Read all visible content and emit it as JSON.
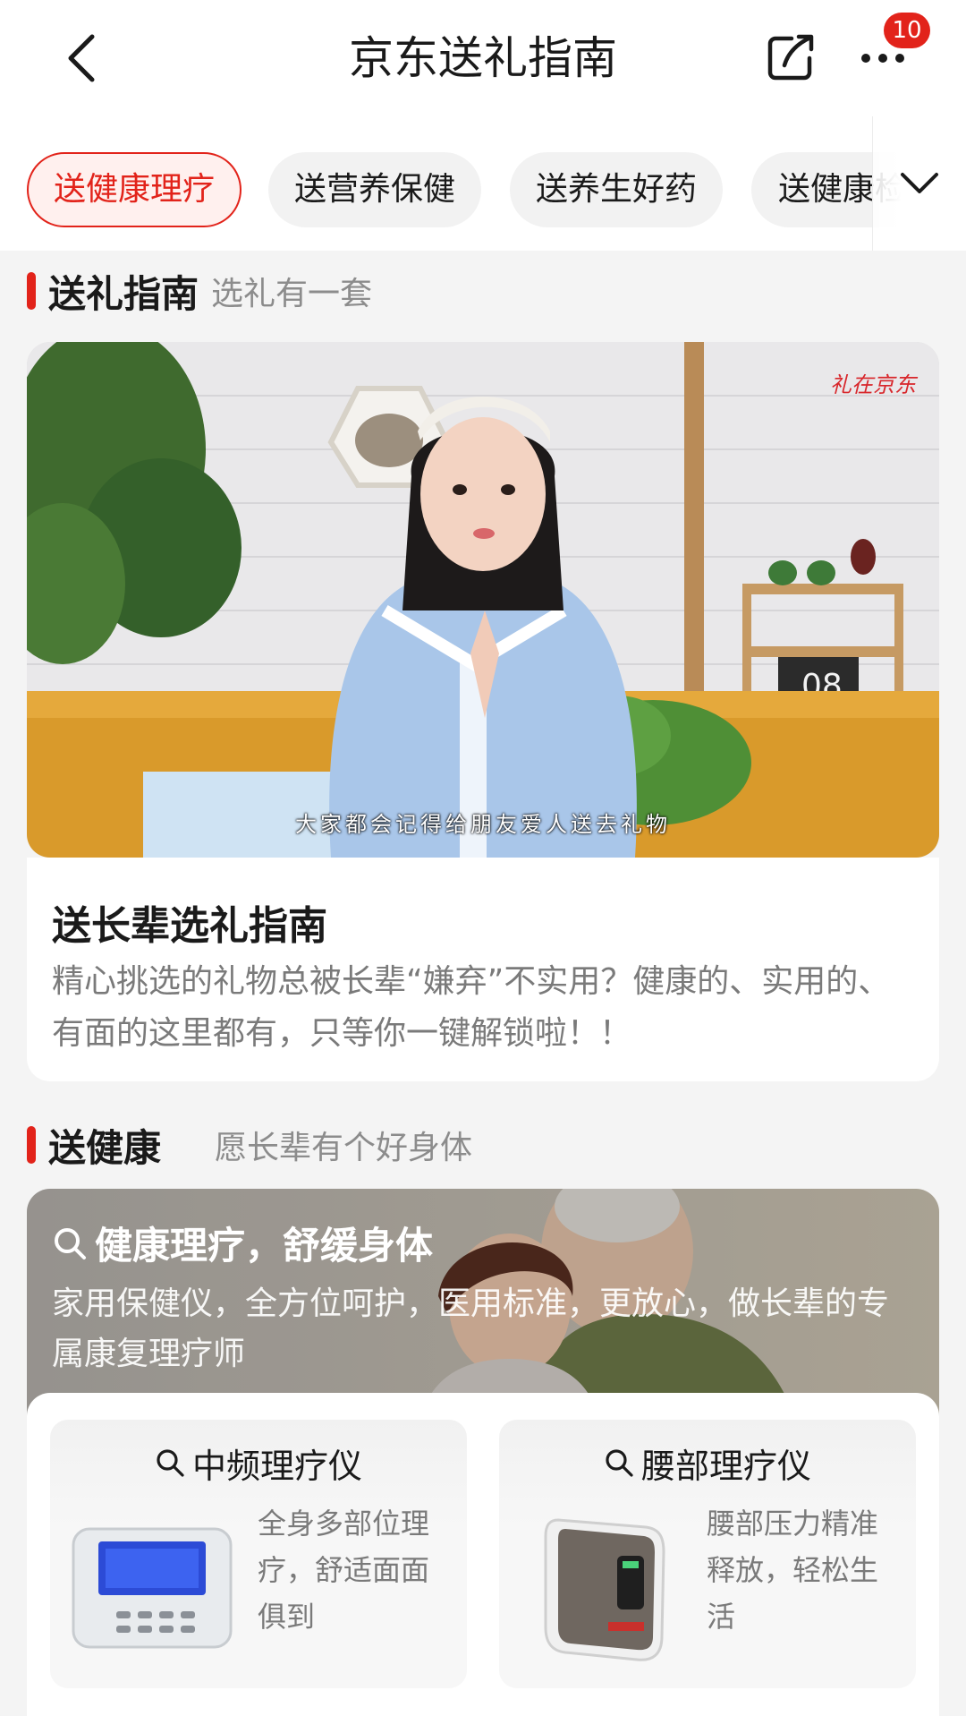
{
  "header": {
    "title": "京东送礼指南",
    "badge_count": "10",
    "back_icon": "chevron-left-icon",
    "share_icon": "share-icon",
    "more_icon": "more-dots-icon"
  },
  "tabs": [
    {
      "label": "送健康理疗",
      "active": true
    },
    {
      "label": "送营养保健",
      "active": false
    },
    {
      "label": "送养生好药",
      "active": false
    },
    {
      "label": "送健康检测",
      "active": false
    }
  ],
  "guide_section": {
    "title": "送礼指南",
    "subtitle": "选礼有一套",
    "video": {
      "logo_text": "礼在京东",
      "caption": "大家都会记得给朋友爱人送去礼物"
    },
    "card_title": "送长辈选礼指南",
    "card_desc": "精心挑选的礼物总被长辈“嫌弃”不实用？健康的、实用的、有面的这里都有，只等你一键解锁啦！！"
  },
  "health_section": {
    "title": "送健康",
    "subtitle": "愿长辈有个好身体",
    "banner": {
      "title": "健康理疗，舒缓身体",
      "desc": "家用保健仪，全方位呵护，医用标准，更放心，做长辈的专属康复理疗师"
    },
    "products": [
      {
        "name": "中频理疗仪",
        "desc": "全身多部位理疗，舒适面面俱到"
      },
      {
        "name": "腰部理疗仪",
        "desc": "腰部压力精准释放，轻松生活"
      }
    ]
  },
  "colors": {
    "accent": "#e2231a",
    "page_bg": "#f4f4f4",
    "muted_text": "#7a7a7a"
  }
}
